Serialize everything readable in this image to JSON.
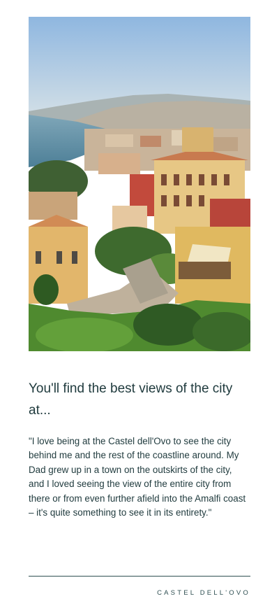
{
  "card": {
    "photo_alt": "Naples city view",
    "heading": "You'll find the best views of the city at...",
    "quote": "\"I love being at the Castel dell'Ovo to see the city behind me and the rest of the coastline around. My Dad grew up in a town on the outskirts of the city, and I loved seeing the view of the entire city from there or from even further afield into the Amalfi coast – it's quite something to see it in its entirety.\"",
    "location": "CASTEL DELL'OVO"
  }
}
